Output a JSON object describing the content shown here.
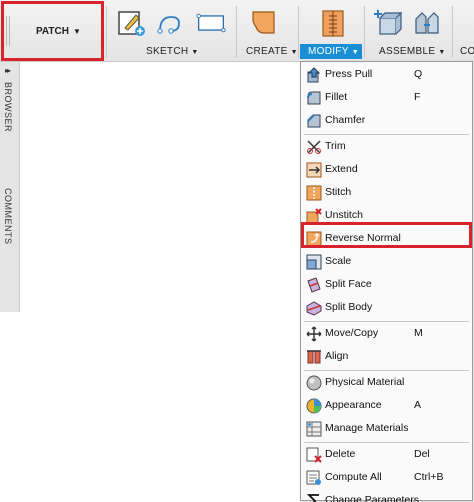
{
  "toolbar": {
    "patch_label": "PATCH",
    "groups": {
      "sketch": "SKETCH",
      "create": "CREATE",
      "modify": "MODIFY",
      "assemble": "ASSEMBLE",
      "partial": "CO"
    },
    "caret": "▼"
  },
  "side_panel": {
    "expand_glyph": "▸▸",
    "browser": "BROWSER",
    "comments": "COMMENTS"
  },
  "menu": {
    "items": [
      {
        "label": "Press Pull",
        "key": "Q",
        "icon": "press-pull-icon"
      },
      {
        "label": "Fillet",
        "key": "F",
        "icon": "fillet-icon"
      },
      {
        "label": "Chamfer",
        "key": "",
        "icon": "chamfer-icon"
      },
      {
        "label": "Trim",
        "key": "",
        "icon": "trim-icon"
      },
      {
        "label": "Extend",
        "key": "",
        "icon": "extend-icon"
      },
      {
        "label": "Stitch",
        "key": "",
        "icon": "stitch-icon"
      },
      {
        "label": "Unstitch",
        "key": "",
        "icon": "unstitch-icon"
      },
      {
        "label": "Reverse Normal",
        "key": "",
        "icon": "reverse-normal-icon"
      },
      {
        "label": "Scale",
        "key": "",
        "icon": "scale-icon"
      },
      {
        "label": "Split Face",
        "key": "",
        "icon": "split-face-icon"
      },
      {
        "label": "Split Body",
        "key": "",
        "icon": "split-body-icon"
      },
      {
        "label": "Move/Copy",
        "key": "M",
        "icon": "move-copy-icon"
      },
      {
        "label": "Align",
        "key": "",
        "icon": "align-icon"
      },
      {
        "label": "Physical Material",
        "key": "",
        "icon": "physical-material-icon"
      },
      {
        "label": "Appearance",
        "key": "A",
        "icon": "appearance-icon"
      },
      {
        "label": "Manage Materials",
        "key": "",
        "icon": "manage-materials-icon"
      },
      {
        "label": "Delete",
        "key": "Del",
        "icon": "delete-icon"
      },
      {
        "label": "Compute All",
        "key": "Ctrl+B",
        "icon": "compute-all-icon"
      },
      {
        "label": "Change Parameters",
        "key": "",
        "icon": "change-parameters-icon"
      }
    ]
  },
  "colors": {
    "highlight_border": "#d9232c",
    "modify_active": "#1a8fd6"
  }
}
